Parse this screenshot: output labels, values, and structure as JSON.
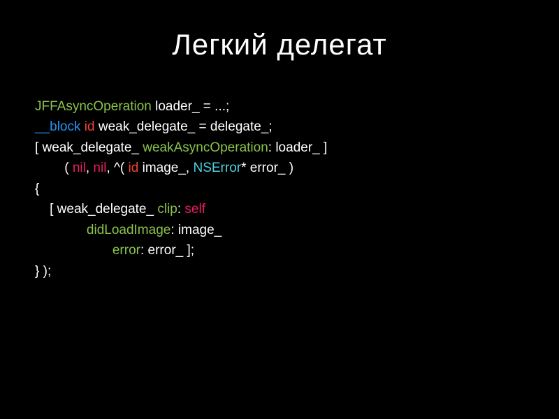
{
  "title": "Легкий делегат",
  "code": {
    "line1": {
      "t1": "JFFAsyncOperation",
      "t2": " loader_ = ...;"
    },
    "line2": {
      "t1": "__block",
      "t2": " id",
      "t3": " weak_delegate_ = delegate_;"
    },
    "line3": {
      "t1": "[ weak_delegate_ ",
      "t2": "weakAsyncOperation",
      "t3": ": loader_ ]"
    },
    "line4": {
      "t1": "        ( ",
      "t2": "nil",
      "t3": ", ",
      "t4": "nil",
      "t5": ", ^( ",
      "t6": "id",
      "t7": " image_, ",
      "t8": "NSError",
      "t9": "* error_ )"
    },
    "line5": {
      "t1": "{"
    },
    "line6": {
      "t1": "    [ weak_delegate_ ",
      "t2": "clip",
      "t3": ": ",
      "t4": "self"
    },
    "line7": {
      "t1": "              ",
      "t2": "didLoadImage",
      "t3": ": image_"
    },
    "line8": {
      "t1": "                     ",
      "t2": "error",
      "t3": ": error_ ];"
    },
    "line9": {
      "t1": "} );"
    }
  }
}
